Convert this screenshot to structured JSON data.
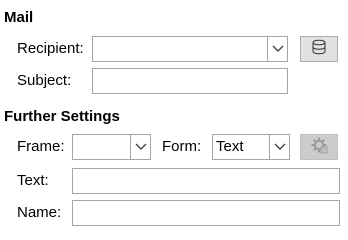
{
  "mail": {
    "heading": "Mail",
    "recipient_label": "Recipient:",
    "recipient_value": "",
    "subject_label": "Subject:",
    "subject_value": ""
  },
  "further": {
    "heading": "Further Settings",
    "frame_label": "Frame:",
    "frame_value": "",
    "form_label": "Form:",
    "form_value": "Text",
    "text_label": "Text:",
    "text_value": "",
    "name_label": "Name:",
    "name_value": ""
  },
  "icons": {
    "address_book": "database-icon",
    "form_button": "gear-form-icon",
    "dropdown": "chevron-down-icon"
  }
}
